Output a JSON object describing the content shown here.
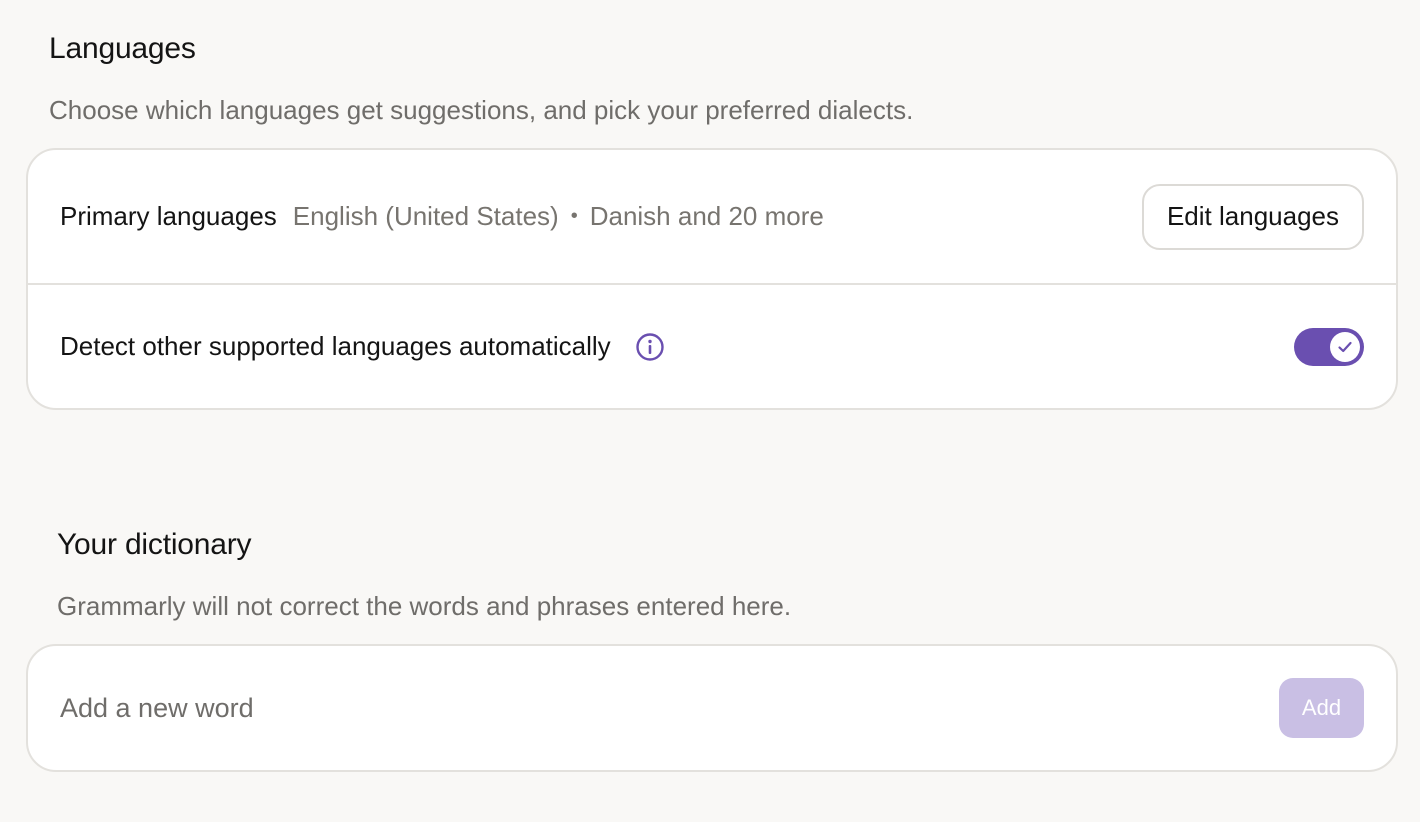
{
  "languages": {
    "title": "Languages",
    "subtitle": "Choose which languages get suggestions, and pick your preferred dialects.",
    "primary": {
      "label": "Primary languages",
      "value_main": "English (United States)",
      "separator": "•",
      "value_more": "Danish and 20 more",
      "edit_button": "Edit languages"
    },
    "detect": {
      "label": "Detect other supported languages automatically",
      "info_icon": "info-icon",
      "toggle_on": true
    }
  },
  "dictionary": {
    "title": "Your dictionary",
    "subtitle": "Grammarly will not correct the words and phrases entered here.",
    "input_value": "",
    "input_placeholder": "Add a new word",
    "add_button": "Add"
  },
  "colors": {
    "accent": "#6a4fb0",
    "accent_disabled": "#c9bfe4",
    "background": "#f9f8f6",
    "card_border": "#e3e1dd"
  }
}
